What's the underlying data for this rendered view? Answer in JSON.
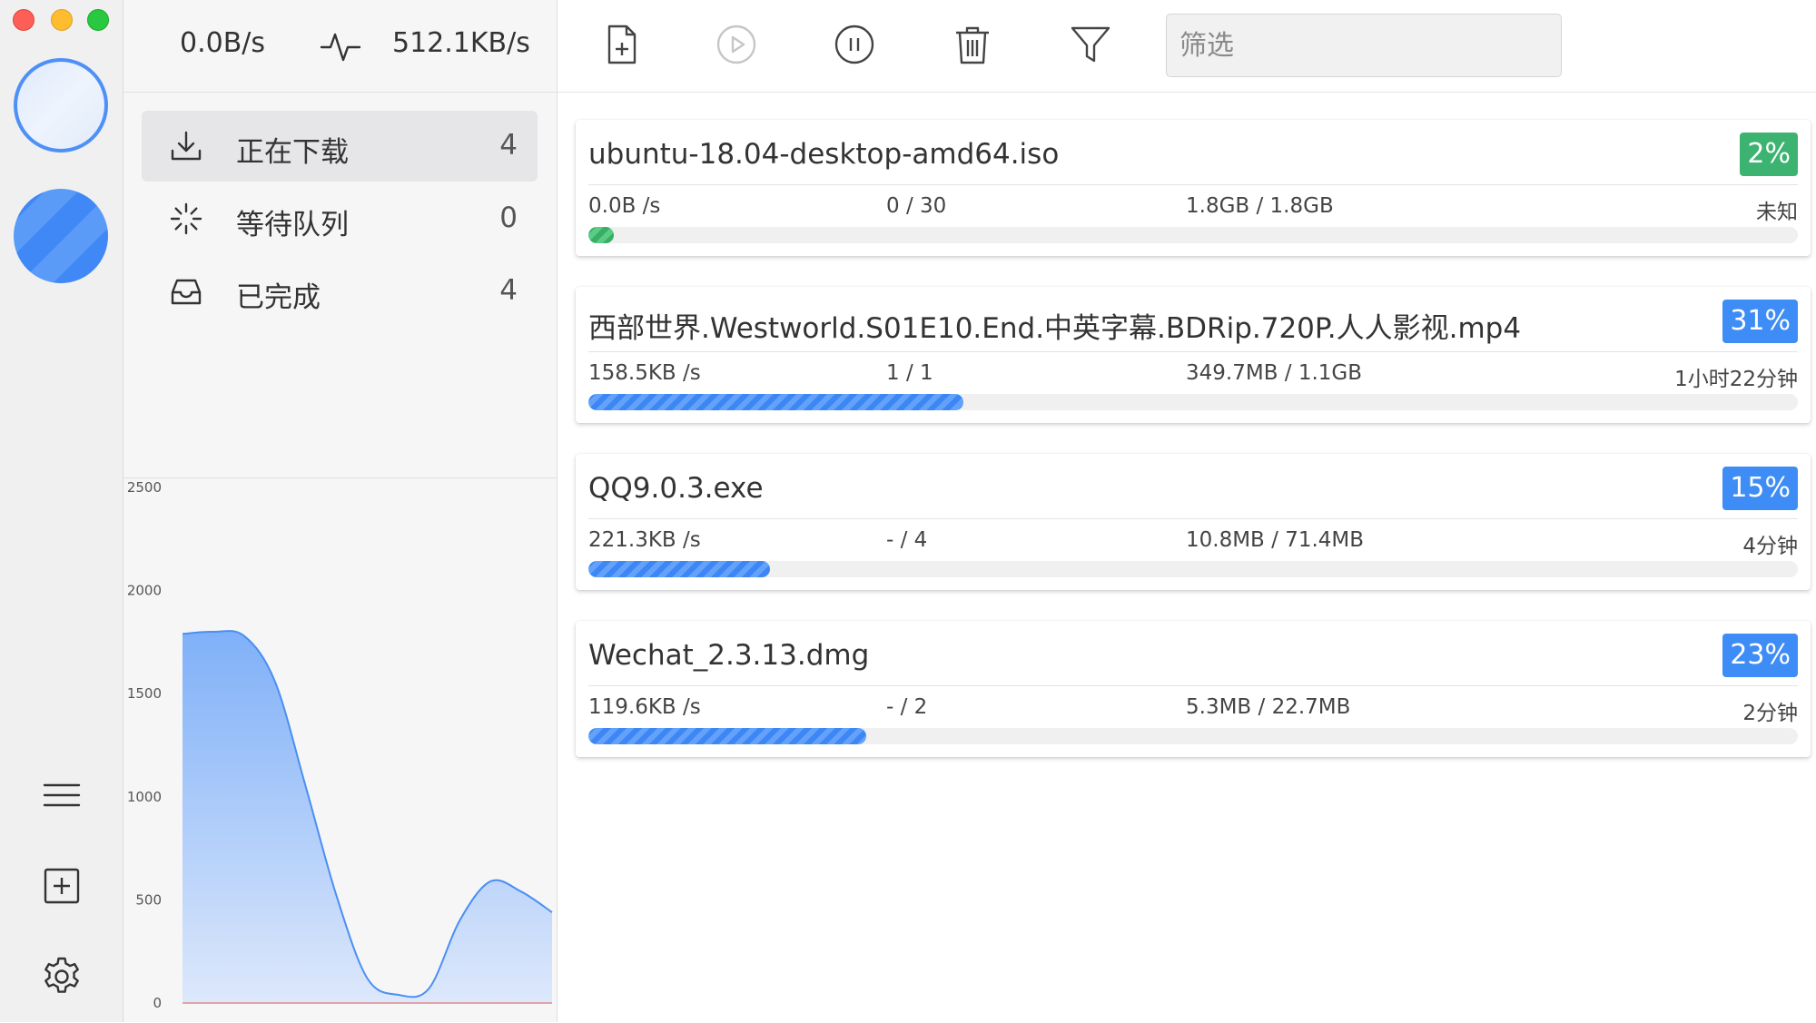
{
  "colors": {
    "accent": "#3e8cf5",
    "success": "#3cb371",
    "rail_bg": "#f0f0f1"
  },
  "speed": {
    "upload": "0.0B/s",
    "download": "512.1KB/s"
  },
  "nav": [
    {
      "label": "正在下载",
      "count": "4",
      "icon": "download-icon",
      "active": true
    },
    {
      "label": "等待队列",
      "count": "0",
      "icon": "spinner-icon",
      "active": false
    },
    {
      "label": "已完成",
      "count": "4",
      "icon": "inbox-icon",
      "active": false
    }
  ],
  "filter": {
    "placeholder": "筛选",
    "value": ""
  },
  "toolbar": [
    "new-task-icon",
    "play-icon",
    "pause-icon",
    "trash-icon",
    "filter-icon"
  ],
  "tasks": [
    {
      "name": "ubuntu-18.04-desktop-amd64.iso",
      "percent": "2%",
      "progress": 0.02,
      "color": "green",
      "speed": "0.0B /s",
      "connections": "0 / 30",
      "size": "1.8GB / 1.8GB",
      "eta": "未知"
    },
    {
      "name": "西部世界.Westworld.S01E10.End.中英字幕.BDRip.720P.人人影视.mp4",
      "percent": "31%",
      "progress": 0.31,
      "color": "blue",
      "speed": "158.5KB /s",
      "connections": "1 / 1",
      "size": "349.7MB / 1.1GB",
      "eta": "1小时22分钟"
    },
    {
      "name": "QQ9.0.3.exe",
      "percent": "15%",
      "progress": 0.15,
      "color": "blue",
      "speed": "221.3KB /s",
      "connections": "- / 4",
      "size": "10.8MB / 71.4MB",
      "eta": "4分钟"
    },
    {
      "name": "Wechat_2.3.13.dmg",
      "percent": "23%",
      "progress": 0.23,
      "color": "blue",
      "speed": "119.6KB /s",
      "connections": "- / 2",
      "size": "5.3MB / 22.7MB",
      "eta": "2分钟"
    }
  ],
  "chart_data": {
    "type": "area",
    "title": "",
    "xlabel": "",
    "ylabel": "",
    "yticks": [
      "2500",
      "2000",
      "1500",
      "1000",
      "500",
      "0"
    ],
    "ylim": [
      0,
      2500
    ],
    "x": [
      0,
      1,
      2,
      3,
      4,
      5,
      6,
      7,
      8,
      9,
      10,
      11,
      12
    ],
    "series": [
      {
        "values": [
          1790,
          1800,
          1780,
          1560,
          1050,
          520,
          120,
          40,
          70,
          400,
          590,
          540,
          440
        ]
      }
    ],
    "grid": false,
    "legend": "none"
  }
}
